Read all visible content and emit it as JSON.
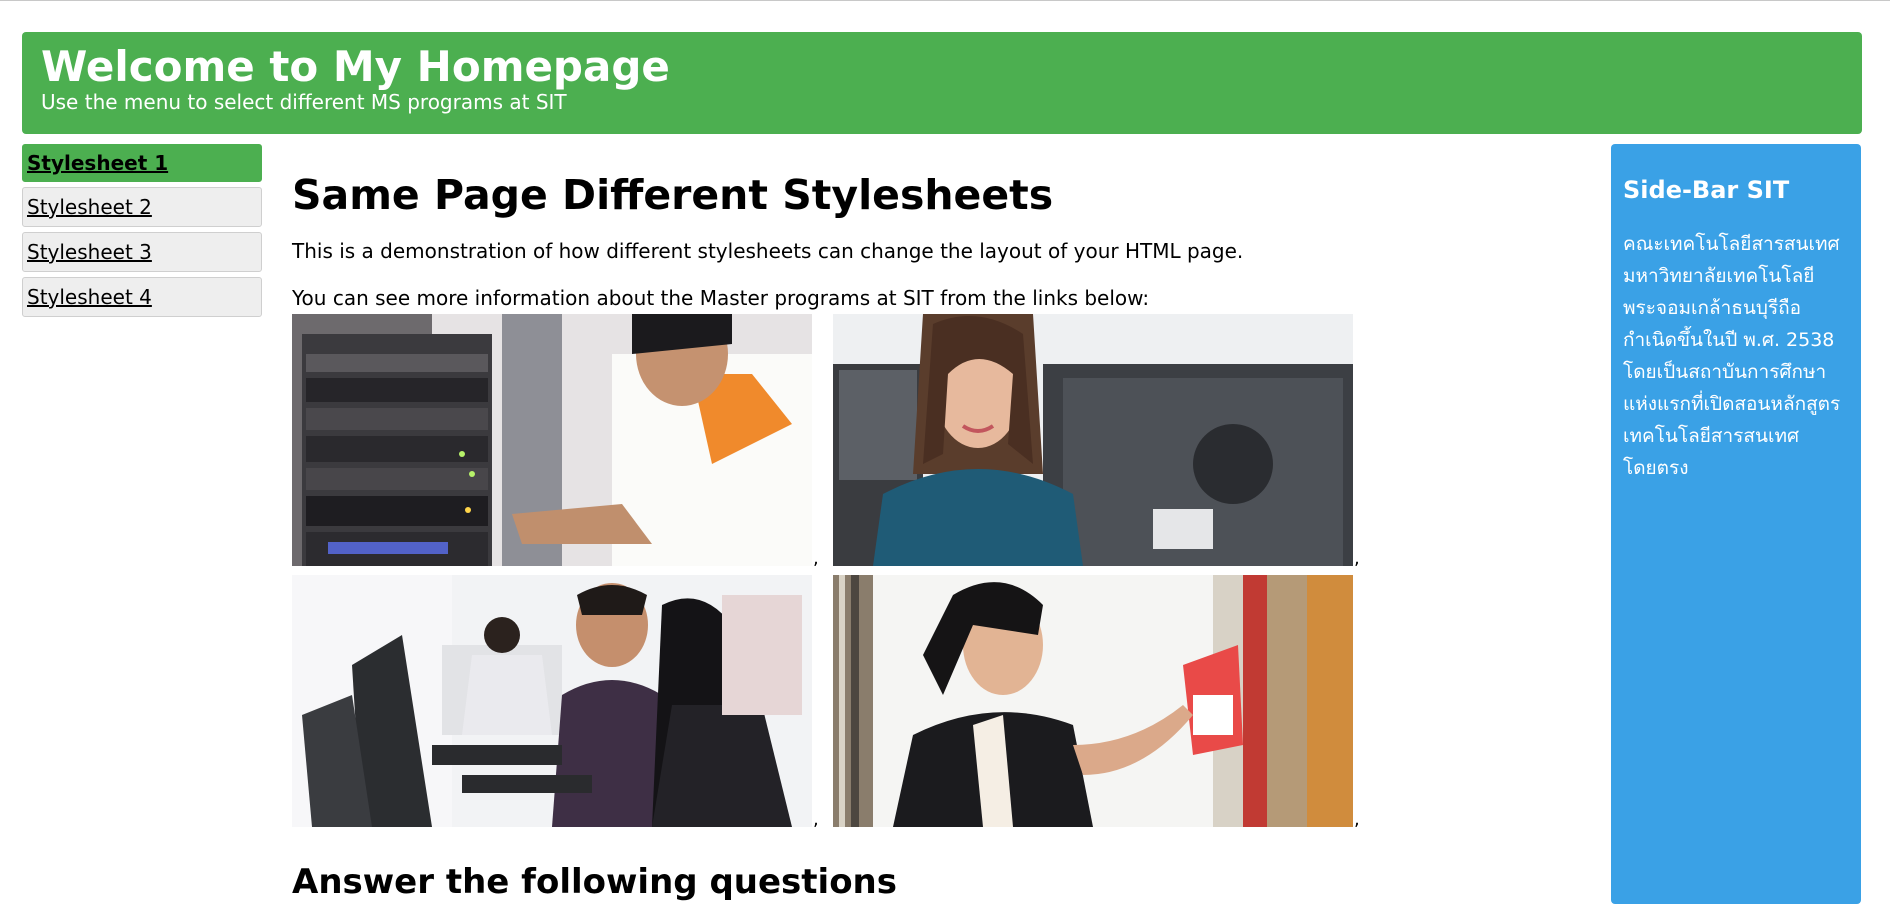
{
  "header": {
    "title": "Welcome to My Homepage",
    "subtitle": "Use the menu to select different MS programs at SIT"
  },
  "menu": {
    "items": [
      {
        "label": "Stylesheet 1",
        "active": true
      },
      {
        "label": "Stylesheet 2",
        "active": false
      },
      {
        "label": "Stylesheet 3",
        "active": false
      },
      {
        "label": "Stylesheet 4",
        "active": false
      }
    ]
  },
  "main": {
    "heading": "Same Page Different Stylesheets",
    "intro": "This is a demonstration of how different stylesheets can change the layout of your HTML page.",
    "links_intro": "You can see more information about the Master programs at SIT from the links below:",
    "photos": [
      {
        "icon": "server-rack-technician-photo"
      },
      {
        "icon": "smiling-woman-at-monitor-photo"
      },
      {
        "icon": "students-at-computers-photo"
      },
      {
        "icon": "woman-at-bookshelf-photo"
      }
    ],
    "next_heading": "Answer the following questions"
  },
  "sidebar": {
    "title": "Side-Bar SIT",
    "text": "คณะเทคโนโลยีสารสนเทศ มหาวิทยาลัยเทคโนโลยีพระจอมเกล้าธนบุรีถือกำเนิดขึ้นในปี พ.ศ. 2538 โดยเป็นสถาบันการศึกษาแห่งแรกที่เปิดสอนหลักสูตรเทคโนโลยีสารสนเทศโดยตรง"
  },
  "colors": {
    "header_bg": "#4caf50",
    "active_menu_bg": "#4caf50",
    "menu_bg": "#eeeeee",
    "sidebar_bg": "#3aa1e6"
  }
}
